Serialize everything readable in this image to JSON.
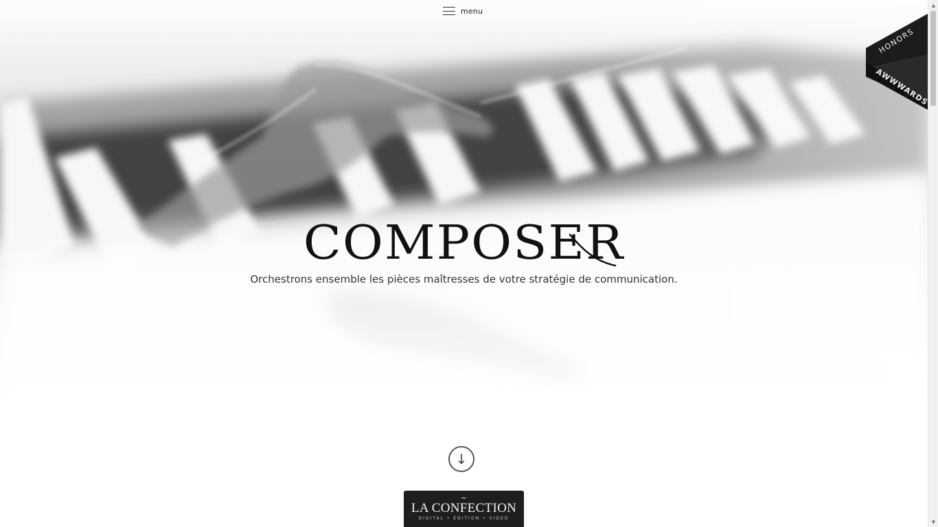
{
  "header": {
    "menu_label": "menu",
    "menu_icon": "hamburger-icon"
  },
  "badge": {
    "top_text": "HONORS",
    "bottom_text": "AWWWARDS",
    "registered_mark": "®"
  },
  "hero": {
    "title": "COMPOSER",
    "subtitle": "Orchestrons ensemble les pièces maîtresses de votre stratégie de communication.",
    "scroll_icon": "arrow-down-icon",
    "scroll_glyph": "↓"
  },
  "logo": {
    "mark": "~",
    "title": "LA CONFECTION",
    "tagline": "DIGITAL • EDITION • VIDEO"
  },
  "colors": {
    "text": "#111111",
    "badge_accent": "#3fbfad",
    "logo_bg": "#1e1e1e"
  }
}
